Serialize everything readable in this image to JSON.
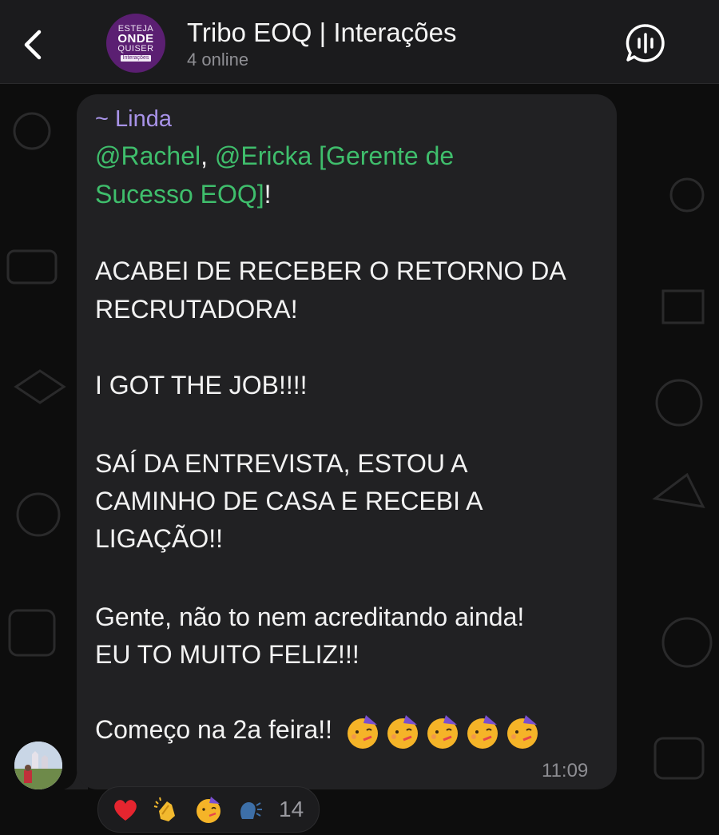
{
  "header": {
    "back_icon": "chevron-left-icon",
    "title": "Tribo EOQ | Interações",
    "subtitle": "4 online",
    "avatar": {
      "line1": "ESTEJA",
      "line2": "ONDE",
      "line3": "QUISER",
      "line4": "Interações",
      "color": "#5b1f72"
    },
    "action_icon": "voice-chat-icon"
  },
  "message": {
    "sender": "~ Linda",
    "mention_at_1": "@",
    "mention_1": "Rachel",
    "separator": ", ",
    "mention_at_2": "@",
    "mention_2_part1": "Ericka [Gerente de",
    "mention_2_part2": "Sucesso EOQ]",
    "mention_end": "!",
    "lines": [
      "ACABEI DE RECEBER O RETORNO DA",
      "RECRUTADORA!",
      "I GOT THE JOB!!!!",
      "SAÍ DA ENTREVISTA, ESTOU A",
      "CAMINHO DE CASA E RECEBI A",
      "LIGAÇÃO!!",
      "Gente, não to nem acreditando ainda!",
      "EU TO MUITO FELIZ!!!",
      "Começo na 2a feira!!"
    ],
    "emojis": [
      "partying-face",
      "partying-face",
      "partying-face",
      "partying-face",
      "partying-face"
    ],
    "time": "11:09",
    "mention_color": "#3fbe6c",
    "sender_color": "#a893e8"
  },
  "reactions": {
    "items": [
      "red-heart",
      "clapping-hands",
      "partying-face",
      "speaking-head"
    ],
    "count": "14"
  }
}
